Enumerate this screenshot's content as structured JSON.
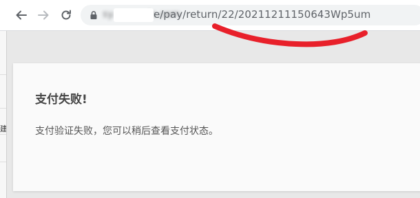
{
  "browser": {
    "url_host": "sy.example.com",
    "url_path": "e/pay/return/22/20211211150643Wp5um",
    "colors": {
      "annotation": "#e8202a",
      "address_bar_bg": "#f1f3f4"
    },
    "icons": {
      "back": "arrow-left-icon",
      "forward": "arrow-right-icon",
      "reload": "reload-icon",
      "lock": "lock-icon"
    }
  },
  "left_window": {
    "partial_text": "建"
  },
  "page": {
    "title": "支付失败!",
    "message": "支付验证失败，您可以稍后查看支付状态。"
  }
}
